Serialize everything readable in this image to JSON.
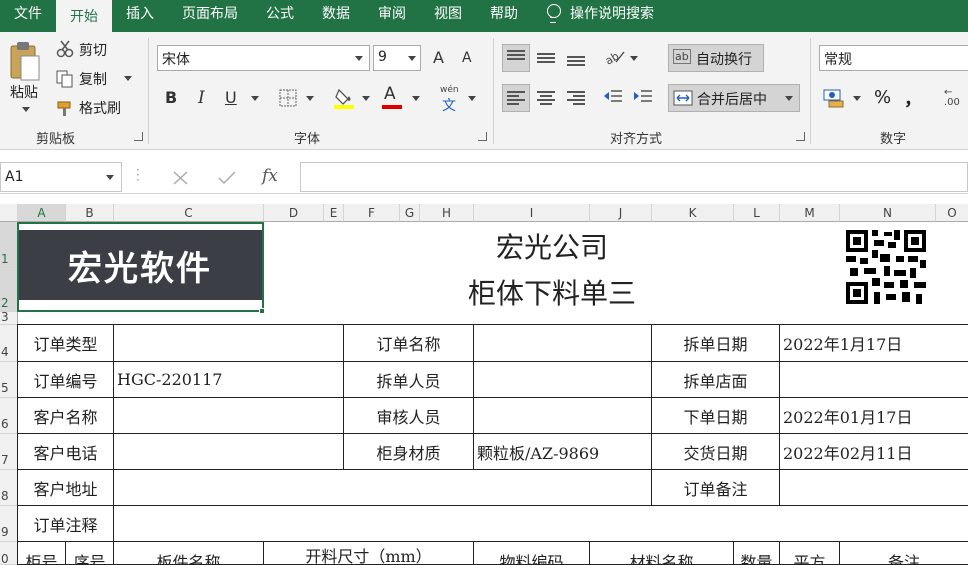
{
  "ribbon_tabs": [
    "文件",
    "开始",
    "插入",
    "页面布局",
    "公式",
    "数据",
    "审阅",
    "视图",
    "帮助"
  ],
  "search_label": "操作说明搜索",
  "clipboard": {
    "paste": "粘贴",
    "cut": "剪切",
    "copy": "复制",
    "painter": "格式刷",
    "label": "剪贴板"
  },
  "font": {
    "name": "宋体",
    "size": "9",
    "label": "字体",
    "bold": "B",
    "italic": "I",
    "underline": "U",
    "grow": "A",
    "shrink": "A",
    "phonetic": "wén"
  },
  "alignment": {
    "wrap": "自动换行",
    "merge": "合并后居中",
    "label": "对齐方式"
  },
  "number": {
    "format": "常规",
    "percent": "%",
    "comma": "，",
    "label": "数字"
  },
  "name_box": "A1",
  "fx": "fx",
  "columns": [
    "A",
    "B",
    "C",
    "D",
    "E",
    "F",
    "G",
    "H",
    "I",
    "J",
    "K",
    "L",
    "M",
    "N",
    "O"
  ],
  "rows": [
    "1",
    "2",
    "3",
    "4",
    "5",
    "6",
    "7",
    "8",
    "9",
    "0"
  ],
  "logo_text": "宏光软件",
  "title1": "宏光公司",
  "title2": "柜体下料单三",
  "form": {
    "r4": [
      "订单类型",
      "",
      "订单名称",
      "",
      "拆单日期",
      "2022年1月17日"
    ],
    "r5": [
      "订单编号",
      "HGC-220117",
      "拆单人员",
      "",
      "拆单店面",
      ""
    ],
    "r6": [
      "客户名称",
      "",
      "审核人员",
      "",
      "下单日期",
      "2022年01月17日"
    ],
    "r7": [
      "客户电话",
      "",
      "柜身材质",
      "颗粒板/AZ-9869",
      "交货日期",
      "2022年02月11日"
    ],
    "r8": [
      "客户地址",
      "",
      "订单备注",
      ""
    ],
    "r9": [
      "订单注释",
      ""
    ],
    "r10": [
      "柜号",
      "序号",
      "板件名称",
      "开料尺寸（mm）",
      "物料编码",
      "材料名称",
      "数量",
      "平方",
      "备注"
    ]
  }
}
